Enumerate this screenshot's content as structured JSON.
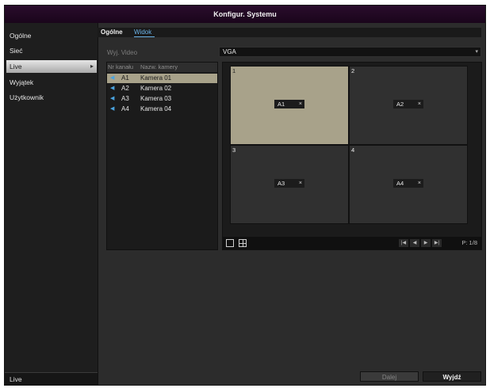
{
  "window": {
    "title": "Konfigur. Systemu"
  },
  "sidebar": {
    "items": [
      {
        "label": "Ogólne",
        "active": false
      },
      {
        "label": "Sieć",
        "active": false
      },
      {
        "label": "Live",
        "active": true
      },
      {
        "label": "Wyjątek",
        "active": false
      },
      {
        "label": "Użytkownik",
        "active": false
      }
    ],
    "footer": "Live",
    "active_chevron": "▸"
  },
  "tabs": [
    {
      "label": "Ogólne",
      "active": false
    },
    {
      "label": "Widok",
      "active": true
    }
  ],
  "video_output": {
    "label": "Wyj. Video",
    "value": "VGA",
    "arrow": "▾"
  },
  "camera_list": {
    "headers": [
      "Nr kanału",
      "Nazw. kamery"
    ],
    "rows": [
      {
        "id": "A1",
        "name": "Kamera 01",
        "selected": true
      },
      {
        "id": "A2",
        "name": "Kamera 02",
        "selected": false
      },
      {
        "id": "A3",
        "name": "Kamera 03",
        "selected": false
      },
      {
        "id": "A4",
        "name": "Kamera 04",
        "selected": false
      }
    ],
    "icon": "camera-icon"
  },
  "preview": {
    "cells": [
      {
        "num": "1",
        "channel": "A1",
        "remove": "×",
        "selected": true
      },
      {
        "num": "2",
        "channel": "A2",
        "remove": "×",
        "selected": false
      },
      {
        "num": "3",
        "channel": "A3",
        "remove": "×",
        "selected": false
      },
      {
        "num": "4",
        "channel": "A4",
        "remove": "×",
        "selected": false
      }
    ],
    "page": "P: 1/8",
    "nav": {
      "prev": "◀",
      "next": "▶",
      "first": "|◀",
      "last": "▶|"
    }
  },
  "buttons": {
    "next": "Dalej",
    "close": "Wyjdź"
  },
  "colors": {
    "title_bar": "#1f0620",
    "selected": "#a8a28a",
    "tab_active": "#6ab2e6"
  }
}
